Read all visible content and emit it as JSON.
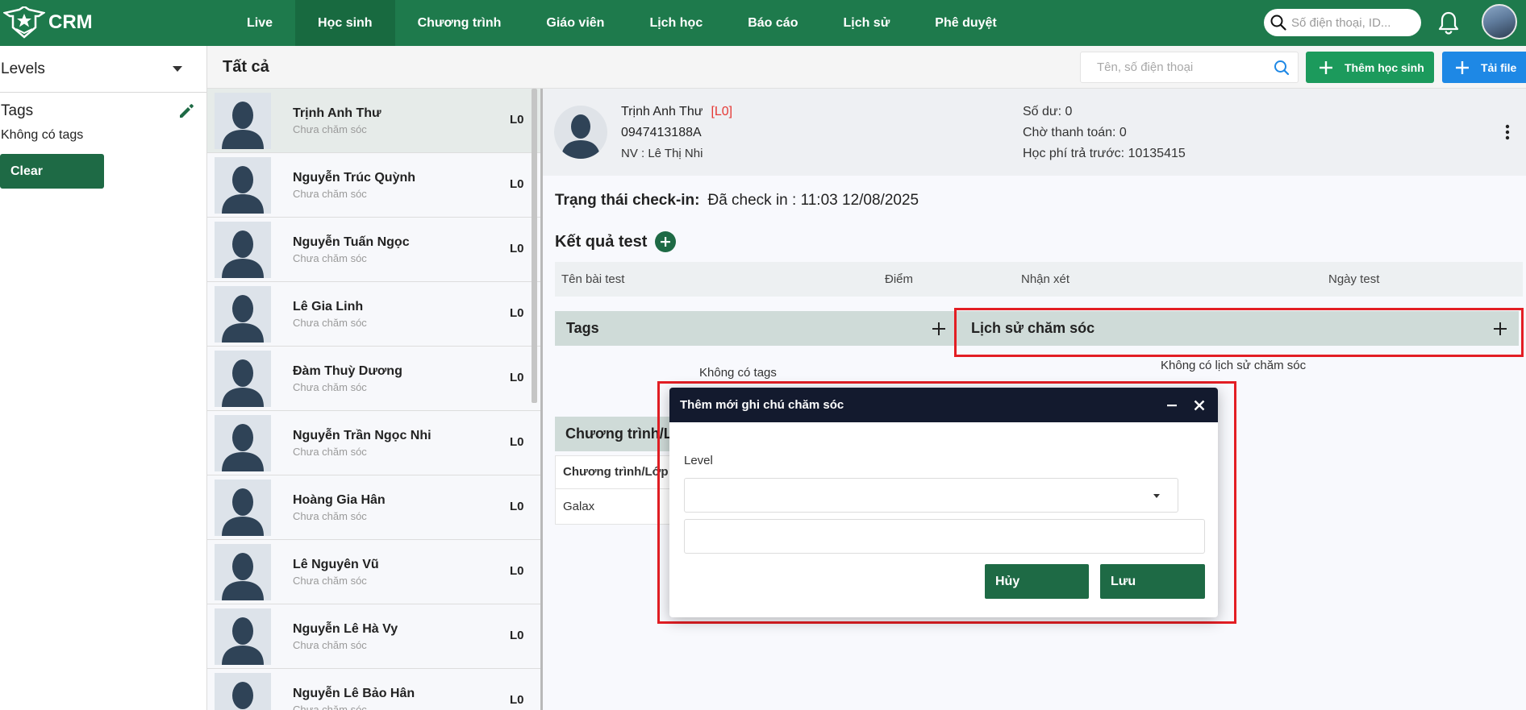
{
  "app": {
    "logo_text": "CRM"
  },
  "nav": {
    "items": [
      {
        "label": "Live"
      },
      {
        "label": "Học sinh"
      },
      {
        "label": "Chương trình"
      },
      {
        "label": "Giáo viên"
      },
      {
        "label": "Lịch học"
      },
      {
        "label": "Báo cáo"
      },
      {
        "label": "Lịch sử"
      },
      {
        "label": "Phê duyệt"
      }
    ],
    "active_index": 1,
    "search_placeholder": "Số điện thoại, ID..."
  },
  "filter": {
    "levels_label": "Levels",
    "tags_label": "Tags",
    "no_tags_text": "Không có tags",
    "clear_label": "Clear"
  },
  "list": {
    "header": "Tất cả",
    "search_placeholder": "Tên, số điện thoại",
    "add_label": "Thêm học sinh",
    "upload_label": "Tải file",
    "students": [
      {
        "name": "Trịnh Anh Thư",
        "status": "Chưa chăm sóc",
        "level": "L0"
      },
      {
        "name": "Nguyễn Trúc Quỳnh",
        "status": "Chưa chăm sóc",
        "level": "L0"
      },
      {
        "name": "Nguyễn Tuấn Ngọc",
        "status": "Chưa chăm sóc",
        "level": "L0"
      },
      {
        "name": "Lê Gia Linh",
        "status": "Chưa chăm sóc",
        "level": "L0"
      },
      {
        "name": "Đàm Thuỳ Dương",
        "status": "Chưa chăm sóc",
        "level": "L0"
      },
      {
        "name": "Nguyễn Trần Ngọc Nhi",
        "status": "Chưa chăm sóc",
        "level": "L0"
      },
      {
        "name": "Hoàng Gia Hân",
        "status": "Chưa chăm sóc",
        "level": "L0"
      },
      {
        "name": "Lê Nguyên Vũ",
        "status": "Chưa chăm sóc",
        "level": "L0"
      },
      {
        "name": "Nguyễn Lê Hà Vy",
        "status": "Chưa chăm sóc",
        "level": "L0"
      },
      {
        "name": "Nguyễn Lê Bảo Hân",
        "status": "Chưa chăm sóc",
        "level": "L0"
      }
    ]
  },
  "profile": {
    "name": "Trịnh Anh Thư",
    "level_tag": "[L0]",
    "phone": "0947413188A",
    "staff": "NV : Lê Thị Nhi",
    "balance": "Số dư: 0",
    "pending": "Chờ thanh toán: 0",
    "prepaid": "Học phí trả trước: 10135415"
  },
  "checkin": {
    "label": "Trạng thái check-in:",
    "value": "Đã check in : 11:03 12/08/2025"
  },
  "tests": {
    "title": "Kết quả test",
    "columns": [
      "Tên bài test",
      "Điểm",
      "Nhận xét",
      "Ngày test"
    ]
  },
  "tags_box": {
    "title": "Tags",
    "empty": "Không có tags"
  },
  "care_box": {
    "title": "Lịch sử chăm sóc",
    "empty": "Không có lịch sử chăm sóc"
  },
  "program_box": {
    "title": "Chương trình/Lớp",
    "column": "Chương trình/Lớp",
    "rows": [
      "Galax"
    ]
  },
  "modal": {
    "title": "Thêm mới ghi chú chăm sóc",
    "level_label": "Level",
    "cancel_label": "Hủy",
    "save_label": "Lưu"
  },
  "colors": {
    "brand_green": "#1e7a4c",
    "dark_green": "#1e6a45",
    "add_green": "#1c9a5c",
    "upload_blue": "#1e88e5",
    "highlight_red": "#e31e24",
    "modal_header": "#131a2e"
  }
}
